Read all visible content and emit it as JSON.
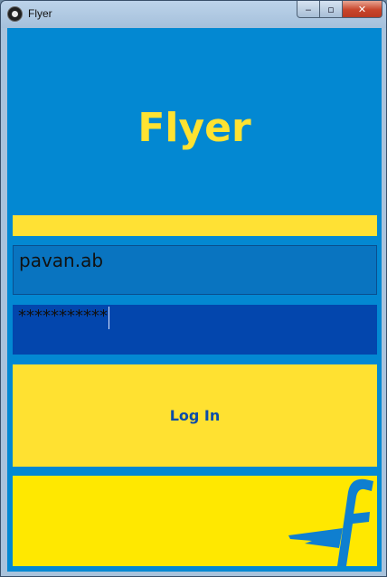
{
  "window": {
    "title": "Flyer",
    "controls": {
      "minimize": "‒",
      "maximize": "▫",
      "close": "✕"
    }
  },
  "app": {
    "brand": "Flyer",
    "username": {
      "value": "pavan.ab"
    },
    "password": {
      "masked_value": "***********"
    },
    "login_label": "Log In"
  },
  "colors": {
    "background_blue": "#0388d2",
    "yellow": "#ffe131",
    "logo_panel_yellow": "#ffe800",
    "password_field": "#0346ad",
    "button_text": "#0b4da8"
  },
  "icons": {
    "logo": "flipkart-f-logo",
    "app_icon": "app-icon"
  }
}
